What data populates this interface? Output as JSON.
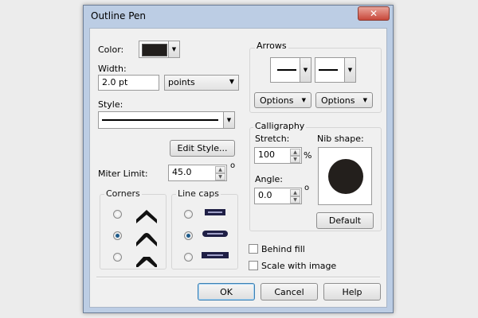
{
  "window": {
    "title": "Outline Pen",
    "close_glyph": "✕"
  },
  "color": {
    "label": "Color:",
    "value": "#221f1d"
  },
  "width": {
    "label": "Width:",
    "value": "2.0 pt",
    "units": "points"
  },
  "style": {
    "label": "Style:",
    "edit_button": "Edit Style..."
  },
  "miter": {
    "label": "Miter Limit:",
    "value": "45.0",
    "unit": "o"
  },
  "corners": {
    "title": "Corners",
    "selected": 2
  },
  "line_caps": {
    "title": "Line caps",
    "selected": 2
  },
  "arrows": {
    "title": "Arrows",
    "options_left": "Options",
    "options_right": "Options"
  },
  "calligraphy": {
    "title": "Calligraphy",
    "stretch_label": "Stretch:",
    "stretch_value": "100",
    "stretch_unit": "%",
    "angle_label": "Angle:",
    "angle_value": "0.0",
    "angle_unit": "o",
    "nib_label": "Nib shape:",
    "default_button": "Default"
  },
  "behind_fill": {
    "label": "Behind fill",
    "checked": false
  },
  "scale_with_image": {
    "label": "Scale with image",
    "checked": false
  },
  "footer": {
    "ok": "OK",
    "cancel": "Cancel",
    "help": "Help"
  },
  "icons": {
    "dropdown": "▼",
    "spin_up": "▲",
    "spin_down": "▼"
  }
}
